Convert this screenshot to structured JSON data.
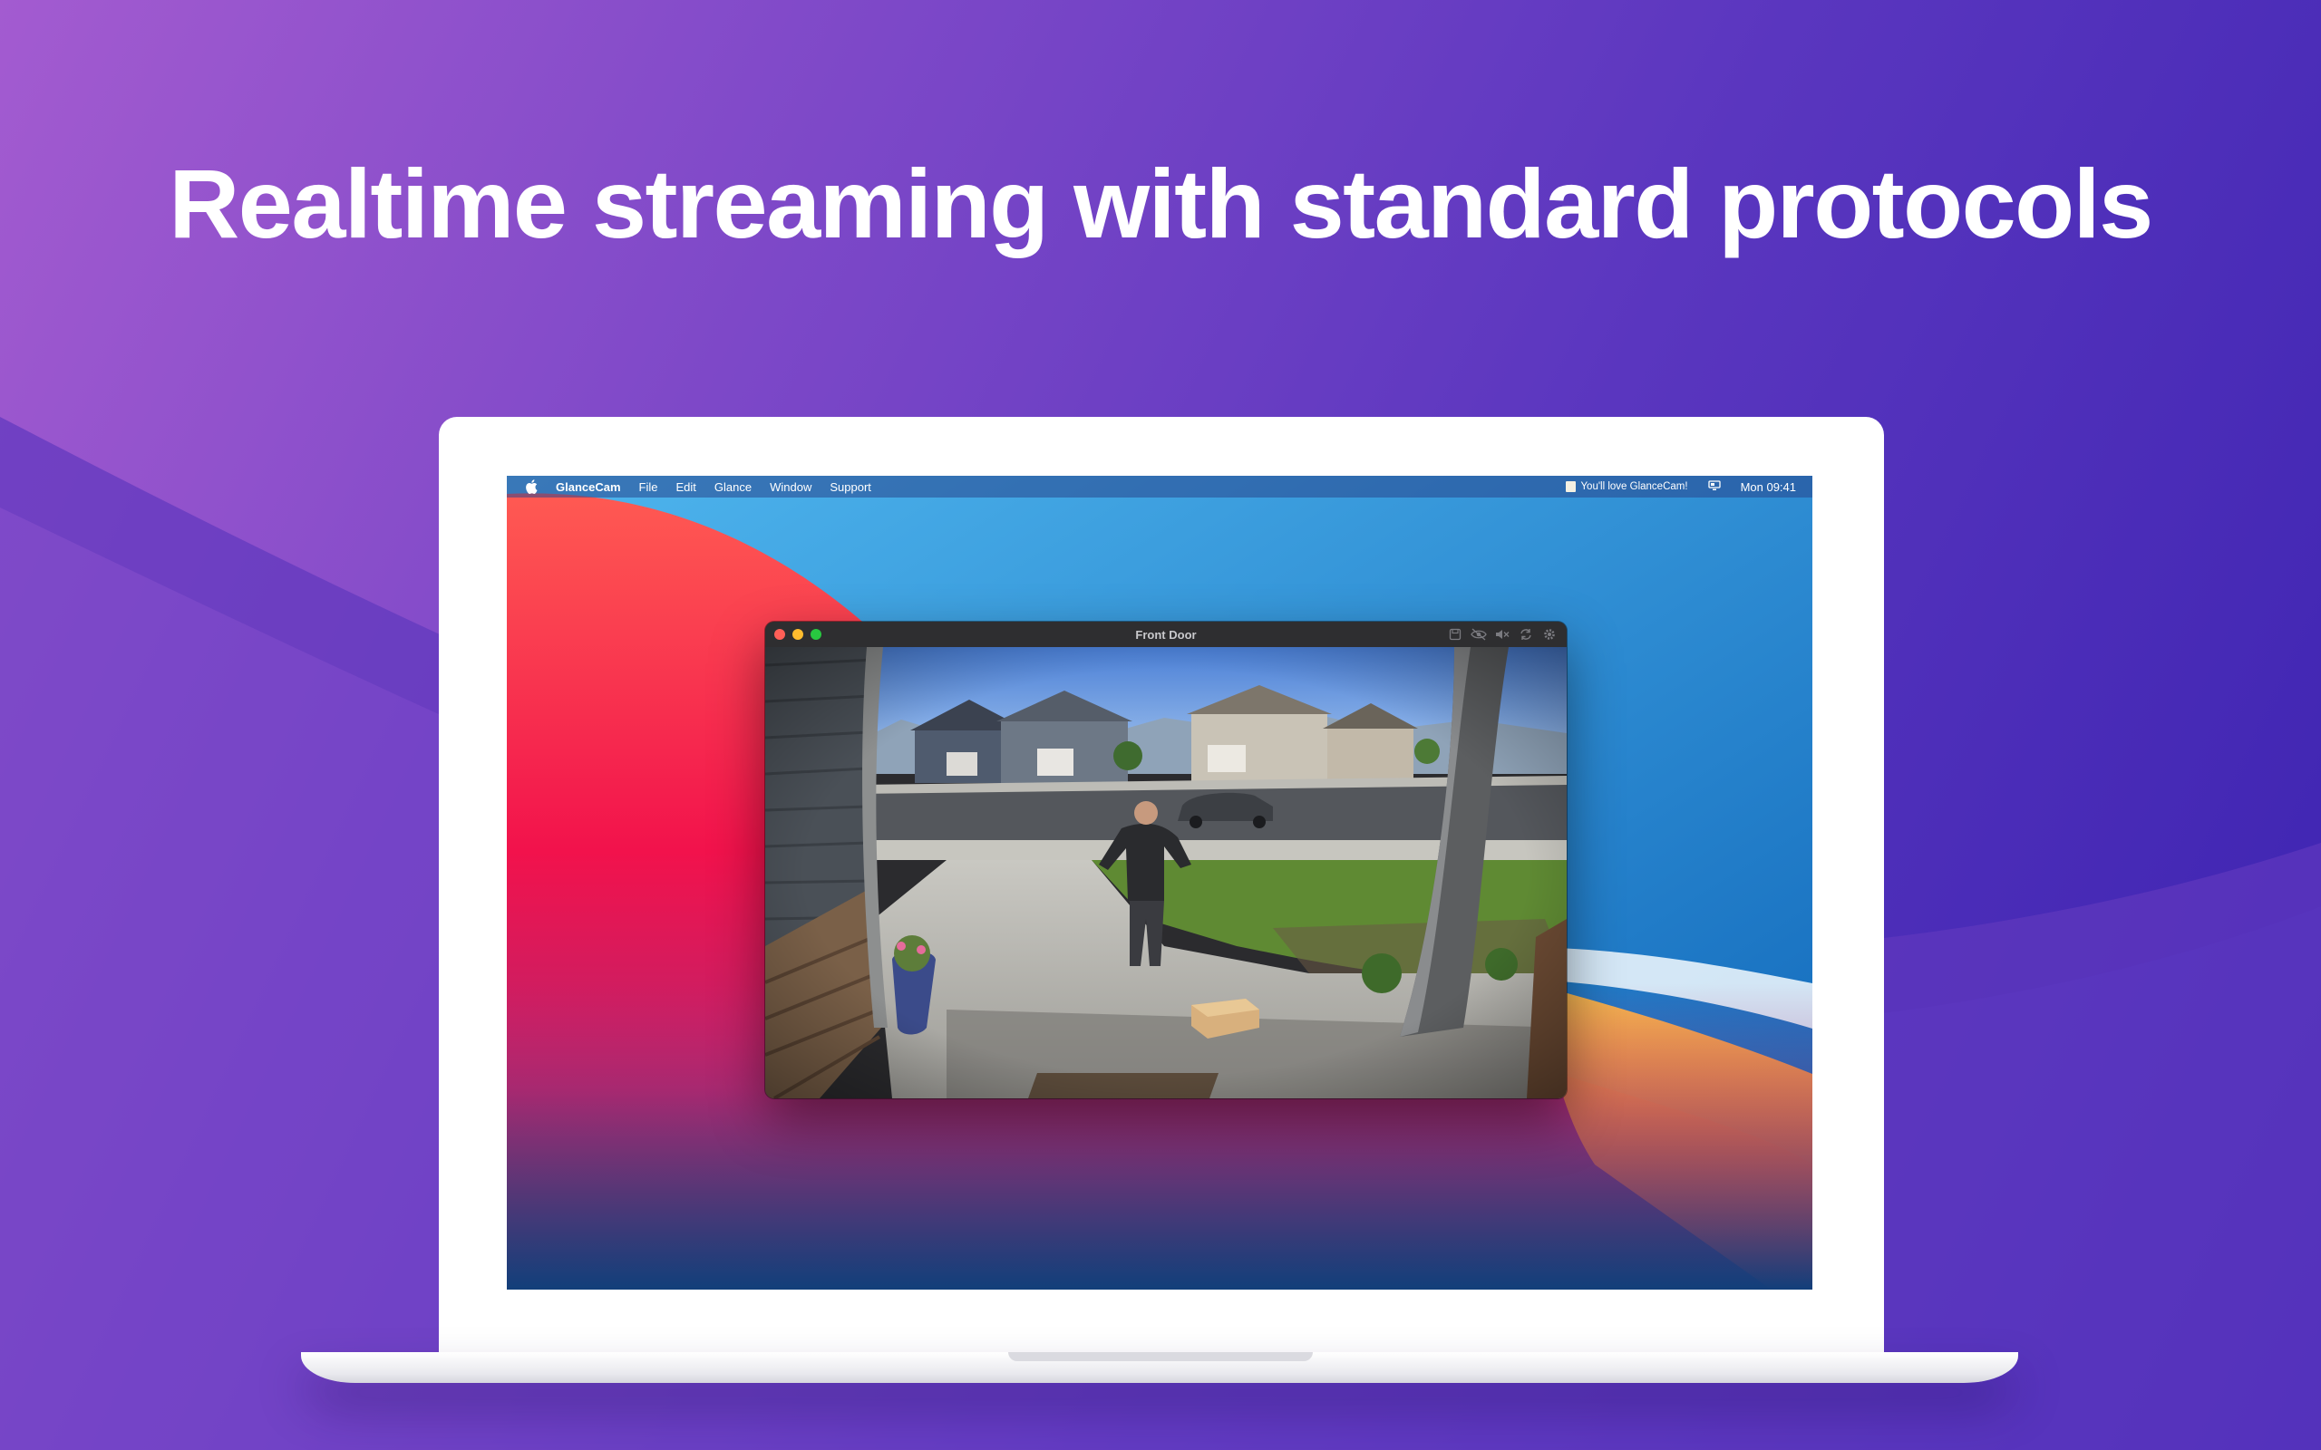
{
  "headline": "Realtime streaming with standard protocols",
  "menubar": {
    "apple_icon": "apple-logo-icon",
    "app_name": "GlanceCam",
    "menus": [
      "File",
      "Edit",
      "Glance",
      "Window",
      "Support"
    ],
    "status_message": "You'll love GlanceCam!",
    "status_icon": "menubar-display-icon",
    "clock": "Mon 09:41"
  },
  "window": {
    "title": "Front Door",
    "traffic_lights": {
      "close": "#ff5f57",
      "minimize": "#febc2e",
      "zoom": "#28c840"
    },
    "toolbar_icons": [
      "save-icon",
      "hide-icon",
      "mute-icon",
      "refresh-icon",
      "gear-icon"
    ],
    "camera_feed": "front-door-camera-feed"
  },
  "colors": {
    "accent_purple": "#7d48c8",
    "accent_blue": "#3a22b0"
  }
}
